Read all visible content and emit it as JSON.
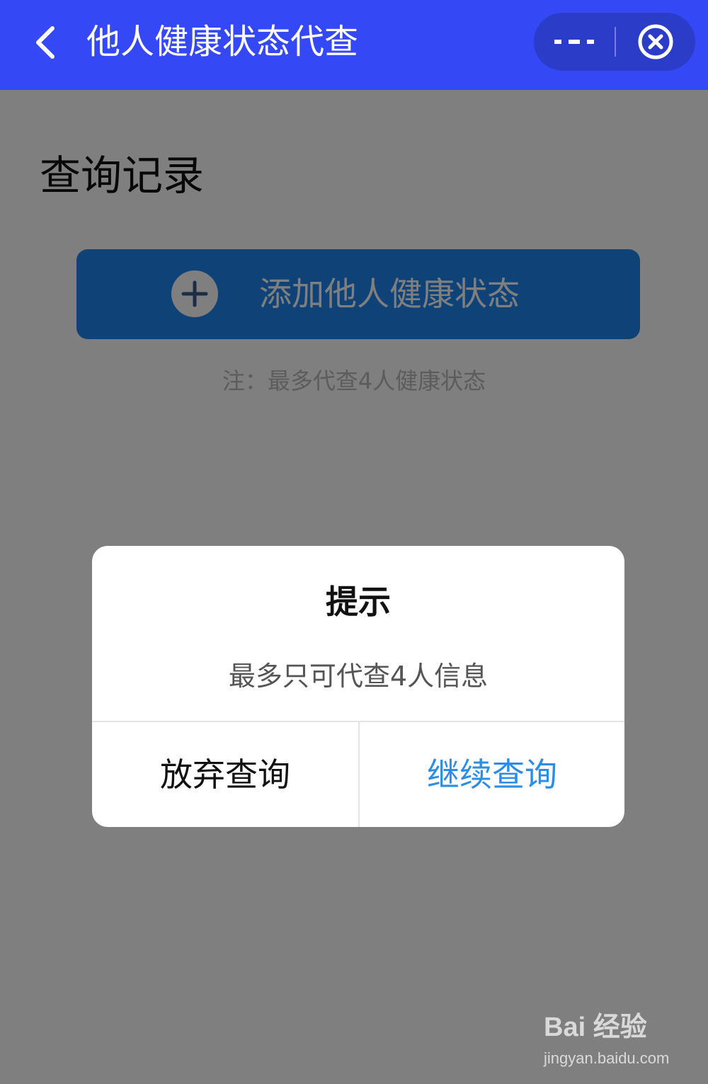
{
  "header": {
    "title": "他人健康状态代查",
    "back_icon": "chevron-left-icon",
    "more_icon": "more-dots-icon",
    "close_icon": "close-circle-icon"
  },
  "content": {
    "section_title": "查询记录",
    "add_button_label": "添加他人健康状态",
    "add_icon": "plus-circle-icon",
    "note": "注：最多代查4人健康状态"
  },
  "dialog": {
    "title": "提示",
    "message": "最多只可代查4人信息",
    "cancel_label": "放弃查询",
    "confirm_label": "继续查询"
  },
  "watermark": {
    "brand": "Bai 经验",
    "url": "jingyan.baidu.com"
  },
  "colors": {
    "header_bg": "#3548f5",
    "primary_button": "#1f86f0",
    "confirm_text": "#2b8de6",
    "overlay": "rgba(0,0,0,0.5)"
  }
}
